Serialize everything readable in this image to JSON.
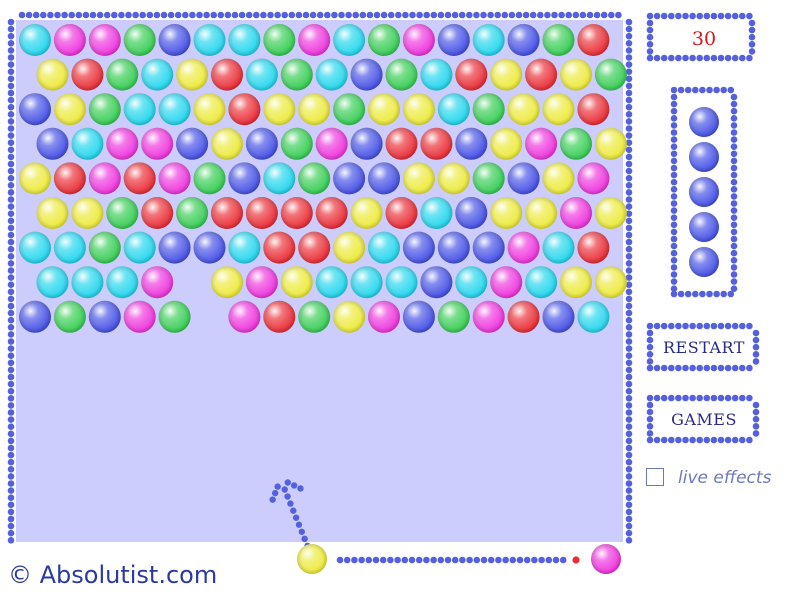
{
  "colors": {
    "c": "#22d6ee",
    "m": "#ef33de",
    "g": "#36cd53",
    "b": "#4450e6",
    "r": "#ea2c34",
    "y": "#ecea38",
    "field_bg": "#ccccfd",
    "bead": "#5560dd"
  },
  "grid_rows": [
    "cmmgbccgmcgmbcbgr",
    "yrgcyrcgcbgcryryg",
    "bygccyryygyycgyyr",
    "bcmmbybgmbrrbymgy",
    "yrmrmgbcgbbyygbym",
    "yygrgrrrryrcbyymy",
    "ccgcbbcrrycbbbmcr",
    "cccm.ymycccbcmcyy",
    "bgbmg.mrgymbgmrbc"
  ],
  "shooter": {
    "current_ball": "y",
    "next_ball": "m",
    "aim_angle_deg": 22
  },
  "score": "30",
  "queue_balls": [
    "b",
    "b",
    "b",
    "b",
    "b"
  ],
  "buttons": {
    "restart": "RESTART",
    "games": "GAMES"
  },
  "options": {
    "live_effects_label": "live effects",
    "live_effects_checked": false
  },
  "branding": "© Absolutist.com"
}
